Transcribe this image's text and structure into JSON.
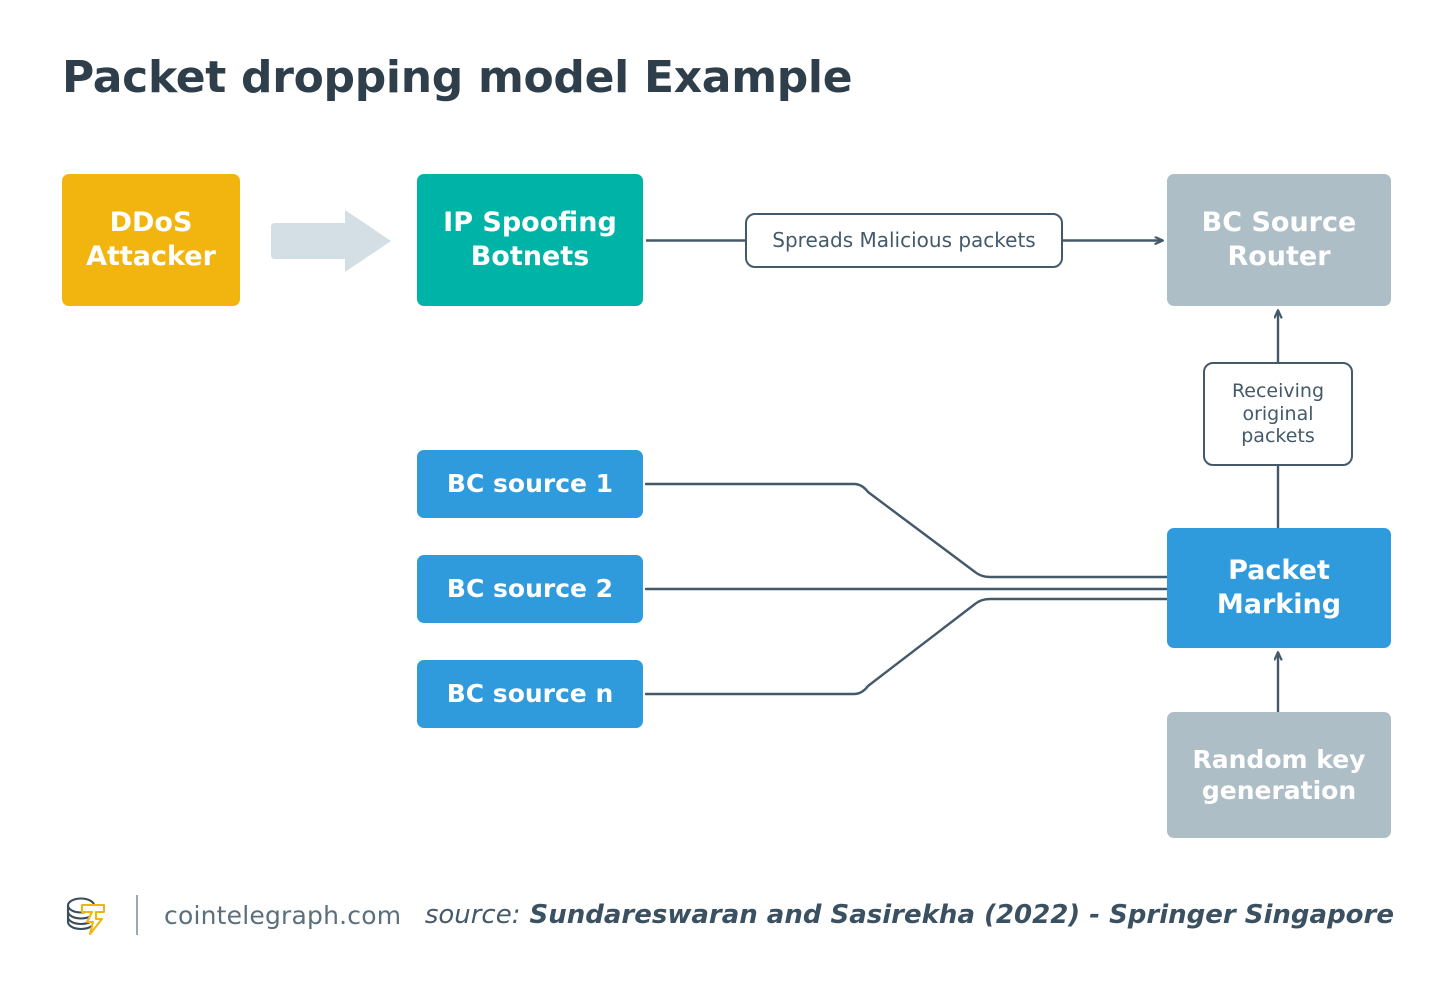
{
  "page": {
    "title": "Packet dropping model Example",
    "background": "#ffffff"
  },
  "palette": {
    "amber": "#F2B50F",
    "teal": "#00B3A7",
    "gray": "#AEBEC6",
    "blue": "#2F9BDC",
    "line": "#44596A",
    "arrow_block": "#D3DFE4",
    "title_text": "#2F3E4B"
  },
  "diagram": {
    "type": "flow-diagram",
    "nodes": [
      {
        "id": "ddos",
        "label": "DDoS\nAttacker",
        "label_line1": "DDoS",
        "label_line2": "Attacker",
        "color": "#F2B50F"
      },
      {
        "id": "botnets",
        "label": "IP Spoofing\nBotnets",
        "label_line1": "IP Spoofing",
        "label_line2": "Botnets",
        "color": "#00B3A7"
      },
      {
        "id": "router",
        "label": "BC Source\nRouter",
        "label_line1": "BC Source",
        "label_line2": "Router",
        "color": "#AEBEC6"
      },
      {
        "id": "src1",
        "label": "BC source 1",
        "color": "#2F9BDC"
      },
      {
        "id": "src2",
        "label": "BC source 2",
        "color": "#2F9BDC"
      },
      {
        "id": "srcn",
        "label": "BC source n",
        "color": "#2F9BDC"
      },
      {
        "id": "marking",
        "label": "Packet\nMarking",
        "label_line1": "Packet",
        "label_line2": "Marking",
        "color": "#2F9BDC"
      },
      {
        "id": "randkey",
        "label": "Random key\ngeneration",
        "label_line1": "Random key",
        "label_line2": "generation",
        "color": "#AEBEC6"
      }
    ],
    "edge_labels": [
      {
        "id": "spreads",
        "text": "Spreads Malicious packets",
        "from": "botnets",
        "to": "router"
      },
      {
        "id": "receiving",
        "text": "Receiving original packets",
        "line1": "Receiving",
        "line2": "original",
        "line3": "packets",
        "from": "marking",
        "to": "router"
      }
    ],
    "edges": [
      {
        "from": "ddos",
        "to": "botnets",
        "style": "block-arrow"
      },
      {
        "from": "botnets",
        "to": "router",
        "style": "arrow",
        "label": "Spreads Malicious packets"
      },
      {
        "from": "src1",
        "to": "marking",
        "style": "line"
      },
      {
        "from": "src2",
        "to": "marking",
        "style": "line"
      },
      {
        "from": "srcn",
        "to": "marking",
        "style": "line"
      },
      {
        "from": "marking",
        "to": "router",
        "style": "arrow",
        "label": "Receiving original packets"
      },
      {
        "from": "randkey",
        "to": "marking",
        "style": "arrow"
      }
    ]
  },
  "footer": {
    "logo": "cointelegraph-logo",
    "site": "cointelegraph.com",
    "source_label": "source:",
    "source_citation": "Sundareswaran and Sasirekha (2022) - Springer Singapore"
  }
}
